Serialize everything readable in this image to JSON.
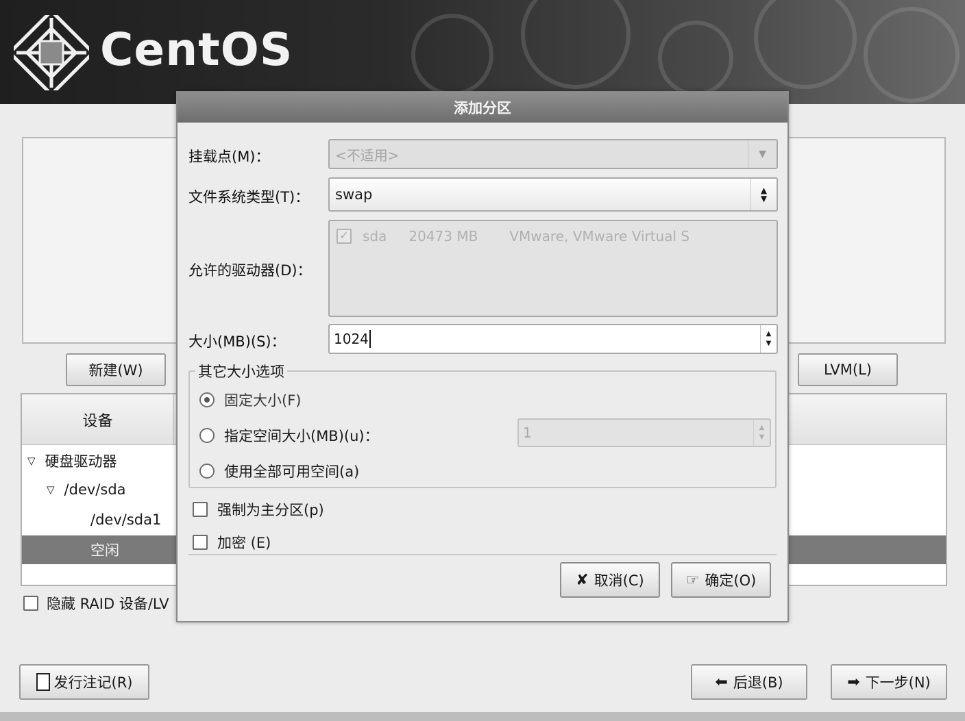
{
  "brand": {
    "name": "CentOS"
  },
  "background": {
    "buttons": {
      "new": "新建(W)",
      "lvm": "LVM(L)",
      "release_notes": "发行注记(R)",
      "back": "后退(B)",
      "next": "下一步(N)"
    },
    "tree": {
      "column_device": "设备",
      "rows": [
        "硬盘驱动器",
        "/dev/sda",
        "/dev/sda1",
        "空闲"
      ]
    },
    "hide_raid_label": "隐藏 RAID 设备/LV"
  },
  "dialog": {
    "title": "添加分区",
    "mount_point": {
      "label": "挂载点(M)：",
      "value": "<不适用>"
    },
    "fs_type": {
      "label": "文件系统类型(T)：",
      "value": "swap"
    },
    "allowed_drives": {
      "label": "允许的驱动器(D)：",
      "rows": [
        {
          "checked": true,
          "name": "sda",
          "size": "20473 MB",
          "model": "VMware, VMware Virtual S"
        }
      ]
    },
    "size": {
      "label": "大小(MB)(S)：",
      "value": "1024"
    },
    "size_options": {
      "legend": "其它大小选项",
      "fixed": "固定大小(F)",
      "max_label": "指定空间大小(MB)(u)：",
      "max_value": "1",
      "fill_all": "使用全部可用空间(a)",
      "selected": "fixed"
    },
    "force_primary": {
      "label": "强制为主分区(p)",
      "checked": false
    },
    "encrypt": {
      "label": "加密 (E)",
      "checked": false
    },
    "cancel_label": "取消(C)",
    "ok_label": "确定(O)"
  }
}
